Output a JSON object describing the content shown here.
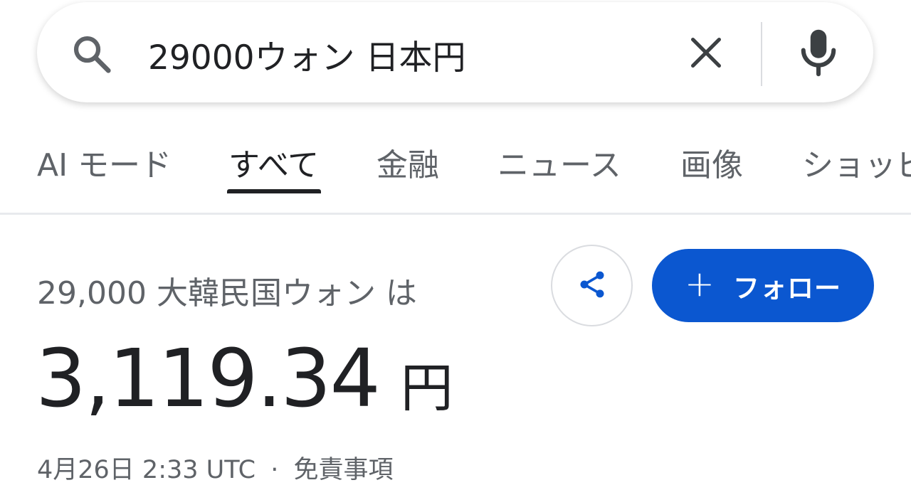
{
  "search": {
    "query": "29000ウォン 日本円"
  },
  "tabs": [
    {
      "label": "AI モード"
    },
    {
      "label": "すべて",
      "active": true
    },
    {
      "label": "金融"
    },
    {
      "label": "ニュース"
    },
    {
      "label": "画像"
    },
    {
      "label": "ショッピ"
    }
  ],
  "result": {
    "subtitle": "29,000 大韓民国ウォン は",
    "value": "3,119.34",
    "unit": "円",
    "timestamp": "4月26日 2:33 UTC",
    "separator": "·",
    "disclaimer": "免責事項"
  },
  "actions": {
    "share_icon": "share-icon",
    "follow_plus": "+",
    "follow_label": "フォロー"
  },
  "colors": {
    "accent": "#0b57d0",
    "icon_gray": "#5f6368",
    "text": "#202124"
  }
}
